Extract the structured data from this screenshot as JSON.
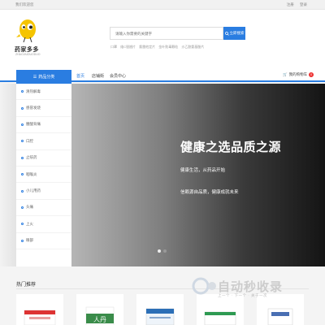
{
  "topbar": {
    "welcome": "我们欢迎您",
    "links": [
      "注册",
      "登录"
    ]
  },
  "brand": {
    "name": "药家多多",
    "sub": "ZHAOJIUDUODUO"
  },
  "search": {
    "placeholder": "请输入你需要的关键字",
    "button_label": "立即搜索"
  },
  "hotwords": [
    "口罩",
    "维C银翘片",
    "氯雷他定片",
    "金叶败毒颗粒",
    "沙乙酰氨基酚片"
  ],
  "nav": {
    "category_label": "药品分类",
    "items": [
      "首页",
      "店铺街",
      "会员中心"
    ],
    "cart_label": "我的购物车",
    "cart_count": "0"
  },
  "categories": [
    "清热解毒",
    "感冒发烧",
    "腰酸背痛",
    "口腔",
    "止咳药",
    "咽喉炎",
    "小儿用药",
    "头痛",
    "上火",
    "眼部"
  ],
  "hero": {
    "title": "健康之选品质之源",
    "line1": "健康生活，从药品开始",
    "line2": "信赖源自品质，健康成就未来"
  },
  "carousel": {
    "count": 2,
    "active": 1
  },
  "hot": {
    "title": "热门推荐",
    "products": [
      {
        "label": "感冒灵颗粒",
        "color": "#d33"
      },
      {
        "label": "人丹",
        "color": "#3a8c4a"
      },
      {
        "label": "对乙酰氨基酚片",
        "color": "#2c6fb7"
      },
      {
        "label": "口腔溃疡散",
        "color": "#2e9a52"
      },
      {
        "label": "复方草珊瑚含片",
        "color": "#4a6fb3"
      }
    ]
  },
  "watermark": {
    "text": "自动秒收录",
    "sub": "上一个 · 下一个 · 关于一次"
  },
  "colors": {
    "accent": "#2a7de1",
    "badge": "#e33333"
  }
}
